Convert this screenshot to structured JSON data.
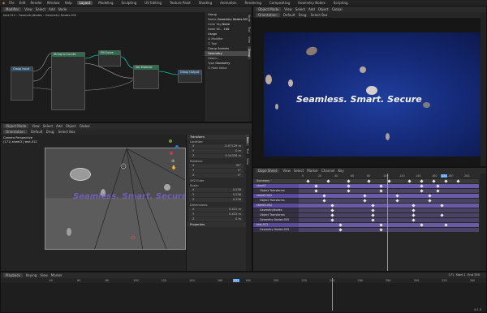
{
  "topbar": {
    "menus": [
      "File",
      "Edit",
      "Render",
      "Window",
      "Help"
    ],
    "workspaces": [
      "Layout",
      "Modeling",
      "Sculpting",
      "UV Editing",
      "Texture Paint",
      "Shading",
      "Animation",
      "Rendering",
      "Compositing",
      "Geometry Nodes",
      "Scripting"
    ],
    "active_workspace": "Layout"
  },
  "node_editor": {
    "header": [
      "Modifier",
      "View",
      "Select",
      "Add",
      "Node"
    ],
    "breadcrumb": [
      "text.012",
      "GeometryNodes",
      "Geometry Nodes.005"
    ],
    "nodes": [
      {
        "title": "Group Input"
      },
      {
        "title": "String to Curves"
      },
      {
        "title": "Fill Curve"
      },
      {
        "title": "Set Material"
      },
      {
        "title": "Group Output"
      }
    ],
    "sidebar": {
      "tabs": [
        "Node",
        "Tool",
        "View",
        "Group"
      ],
      "group_heading": "Group",
      "fields": [
        {
          "label": "Name",
          "value": "Geometry Nodes.005"
        },
        {
          "label": "Color Tag",
          "value": "None"
        },
        {
          "label": "Node Wi...",
          "value": "140"
        }
      ],
      "usage_heading": "Usage",
      "usage_options": [
        "Modifier",
        "Tool"
      ],
      "sockets_heading": "Group Sockets",
      "sockets": [
        "Geometry",
        "Geom..."
      ],
      "type_label": "Type",
      "type_value": "Geometry",
      "hide_value": "Hide Value"
    }
  },
  "viewport": {
    "header": [
      "Object Mode",
      "View",
      "Select",
      "Add",
      "Object",
      "Global"
    ],
    "subheader": [
      "Orientation:",
      "Default",
      "Drag:",
      "Select Box"
    ],
    "camera_info": [
      "Camera Perspective",
      "(171) sheet3 | text.012"
    ],
    "overlay_text": "Seamless. Smart. Secure",
    "tabs": [
      "Item",
      "Tool",
      "View"
    ],
    "transform_heading": "Transform",
    "location_label": "Location:",
    "location": [
      {
        "axis": "X",
        "value": "-0.07129 m"
      },
      {
        "axis": "Y",
        "value": "0 m"
      },
      {
        "axis": "Z",
        "value": "0.14376 m"
      }
    ],
    "rotation_label": "Rotation:",
    "rotation": [
      {
        "axis": "X",
        "value": "90°"
      },
      {
        "axis": "Y",
        "value": "0°"
      },
      {
        "axis": "Z",
        "value": "0°"
      }
    ],
    "rotation_mode": "XYZ Euler",
    "scale_label": "Scale:",
    "scale": [
      {
        "axis": "X",
        "value": "0.236"
      },
      {
        "axis": "Y",
        "value": "0.236"
      },
      {
        "axis": "Z",
        "value": "0.236"
      }
    ],
    "dimensions_label": "Dimensions:",
    "dimensions": [
      {
        "axis": "X",
        "value": "0.422 m"
      },
      {
        "axis": "Y",
        "value": "0.422 m"
      },
      {
        "axis": "Z",
        "value": "0 m"
      }
    ],
    "properties_heading": "Properties"
  },
  "render_view": {
    "header": [
      "Object Mode",
      "View",
      "Select",
      "Add",
      "Object",
      "Global"
    ],
    "subheader": [
      "Orientation:",
      "Default",
      "Drag:",
      "Select Box"
    ],
    "headline": "Seamless. Smart. Secure"
  },
  "dopesheet": {
    "header": [
      "Dope Sheet",
      "View",
      "Select",
      "Marker",
      "Channel",
      "Key"
    ],
    "frame_numbers": [
      "0",
      "20",
      "40",
      "60",
      "80",
      "100",
      "120",
      "140",
      "160",
      "171",
      "180",
      "200"
    ],
    "current_frame": "171",
    "channels": [
      {
        "name": "Summary",
        "kind": "summary"
      },
      {
        "name": "sheet3",
        "kind": "object"
      },
      {
        "name": "Object Transforms",
        "kind": "sub"
      },
      {
        "name": "sheet3.001",
        "kind": "object"
      },
      {
        "name": "Object Transforms",
        "kind": "sub"
      },
      {
        "name": "sheet3.002",
        "kind": "object"
      },
      {
        "name": "GeometryNodes",
        "kind": "sub"
      },
      {
        "name": "Object Transforms",
        "kind": "sub"
      },
      {
        "name": "Geometry Nodes.005",
        "kind": "sub"
      },
      {
        "name": "text.012",
        "kind": "object"
      },
      {
        "name": "Geometry Nodes.005",
        "kind": "sub"
      }
    ]
  },
  "timeline": {
    "header": [
      "Playback",
      "Keying",
      "View",
      "Marker"
    ],
    "start_label": "Start",
    "start": "1",
    "end_label": "End",
    "end": "350",
    "current": "171",
    "ticks": [
      "40",
      "60",
      "80",
      "100",
      "120",
      "140",
      "160",
      "171",
      "180",
      "200",
      "220",
      "240",
      "260",
      "280",
      "300",
      "320",
      "340"
    ],
    "version": "4.2.0"
  },
  "colors": {
    "accent": "#6b4fd3",
    "keyframe": "#e6e6e6",
    "dopesheet_row": "#6a5aa8"
  }
}
